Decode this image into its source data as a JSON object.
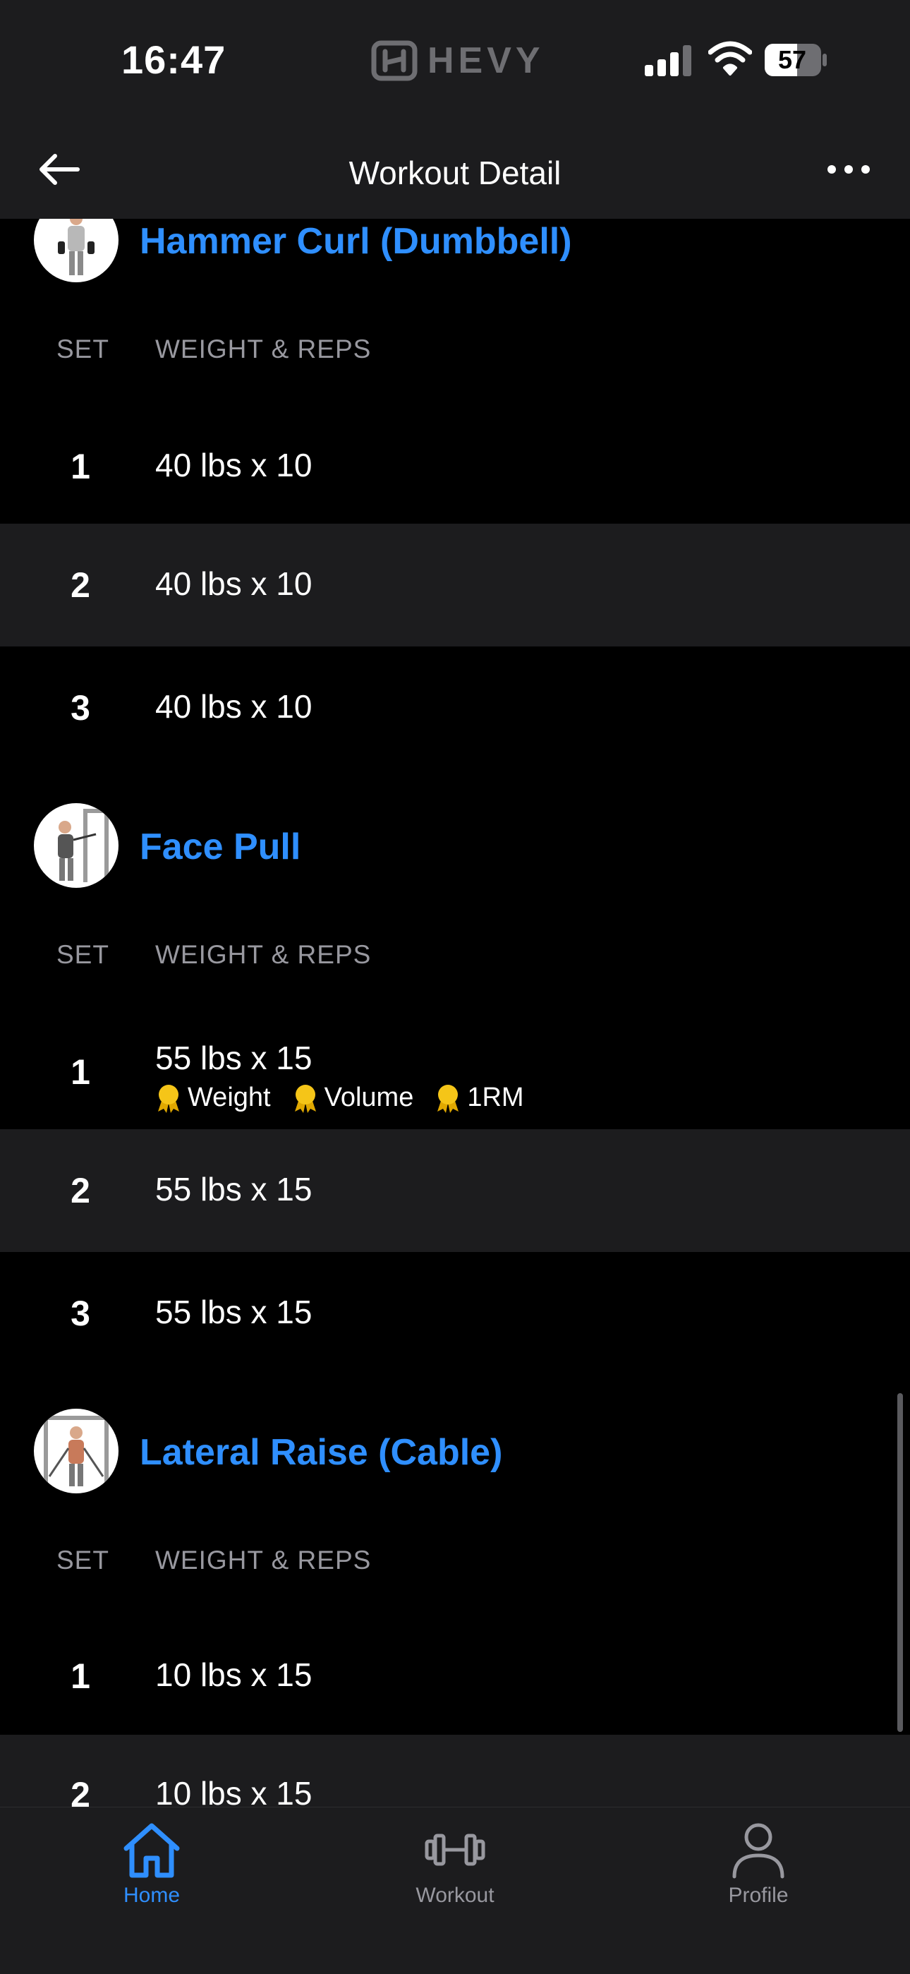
{
  "status_bar": {
    "time": "16:47",
    "brand": "HEVY",
    "battery": "57"
  },
  "header": {
    "title": "Workout Detail"
  },
  "columns": {
    "set": "SET",
    "weight_reps": "WEIGHT & REPS"
  },
  "exercises": [
    {
      "name": "Hammer Curl (Dumbbell)",
      "sets": [
        {
          "set": "1",
          "value": "40 lbs x 10"
        },
        {
          "set": "2",
          "value": "40 lbs x 10"
        },
        {
          "set": "3",
          "value": "40 lbs x 10"
        }
      ]
    },
    {
      "name": "Face Pull",
      "sets": [
        {
          "set": "1",
          "value": "55 lbs x 15",
          "records": [
            "Weight",
            "Volume",
            "1RM"
          ]
        },
        {
          "set": "2",
          "value": "55 lbs x 15"
        },
        {
          "set": "3",
          "value": "55 lbs x 15"
        }
      ]
    },
    {
      "name": "Lateral Raise (Cable)",
      "sets": [
        {
          "set": "1",
          "value": "10 lbs x 15"
        },
        {
          "set": "2",
          "value": "10 lbs x 15"
        }
      ]
    }
  ],
  "tabs": [
    {
      "label": "Home",
      "icon": "home-icon",
      "active": true
    },
    {
      "label": "Workout",
      "icon": "dumbbell-icon",
      "active": false
    },
    {
      "label": "Profile",
      "icon": "person-icon",
      "active": false
    }
  ],
  "colors": {
    "accent": "#2f8fff",
    "medal": "#f5c518",
    "background": "#000000",
    "surface": "#1c1c1e"
  }
}
